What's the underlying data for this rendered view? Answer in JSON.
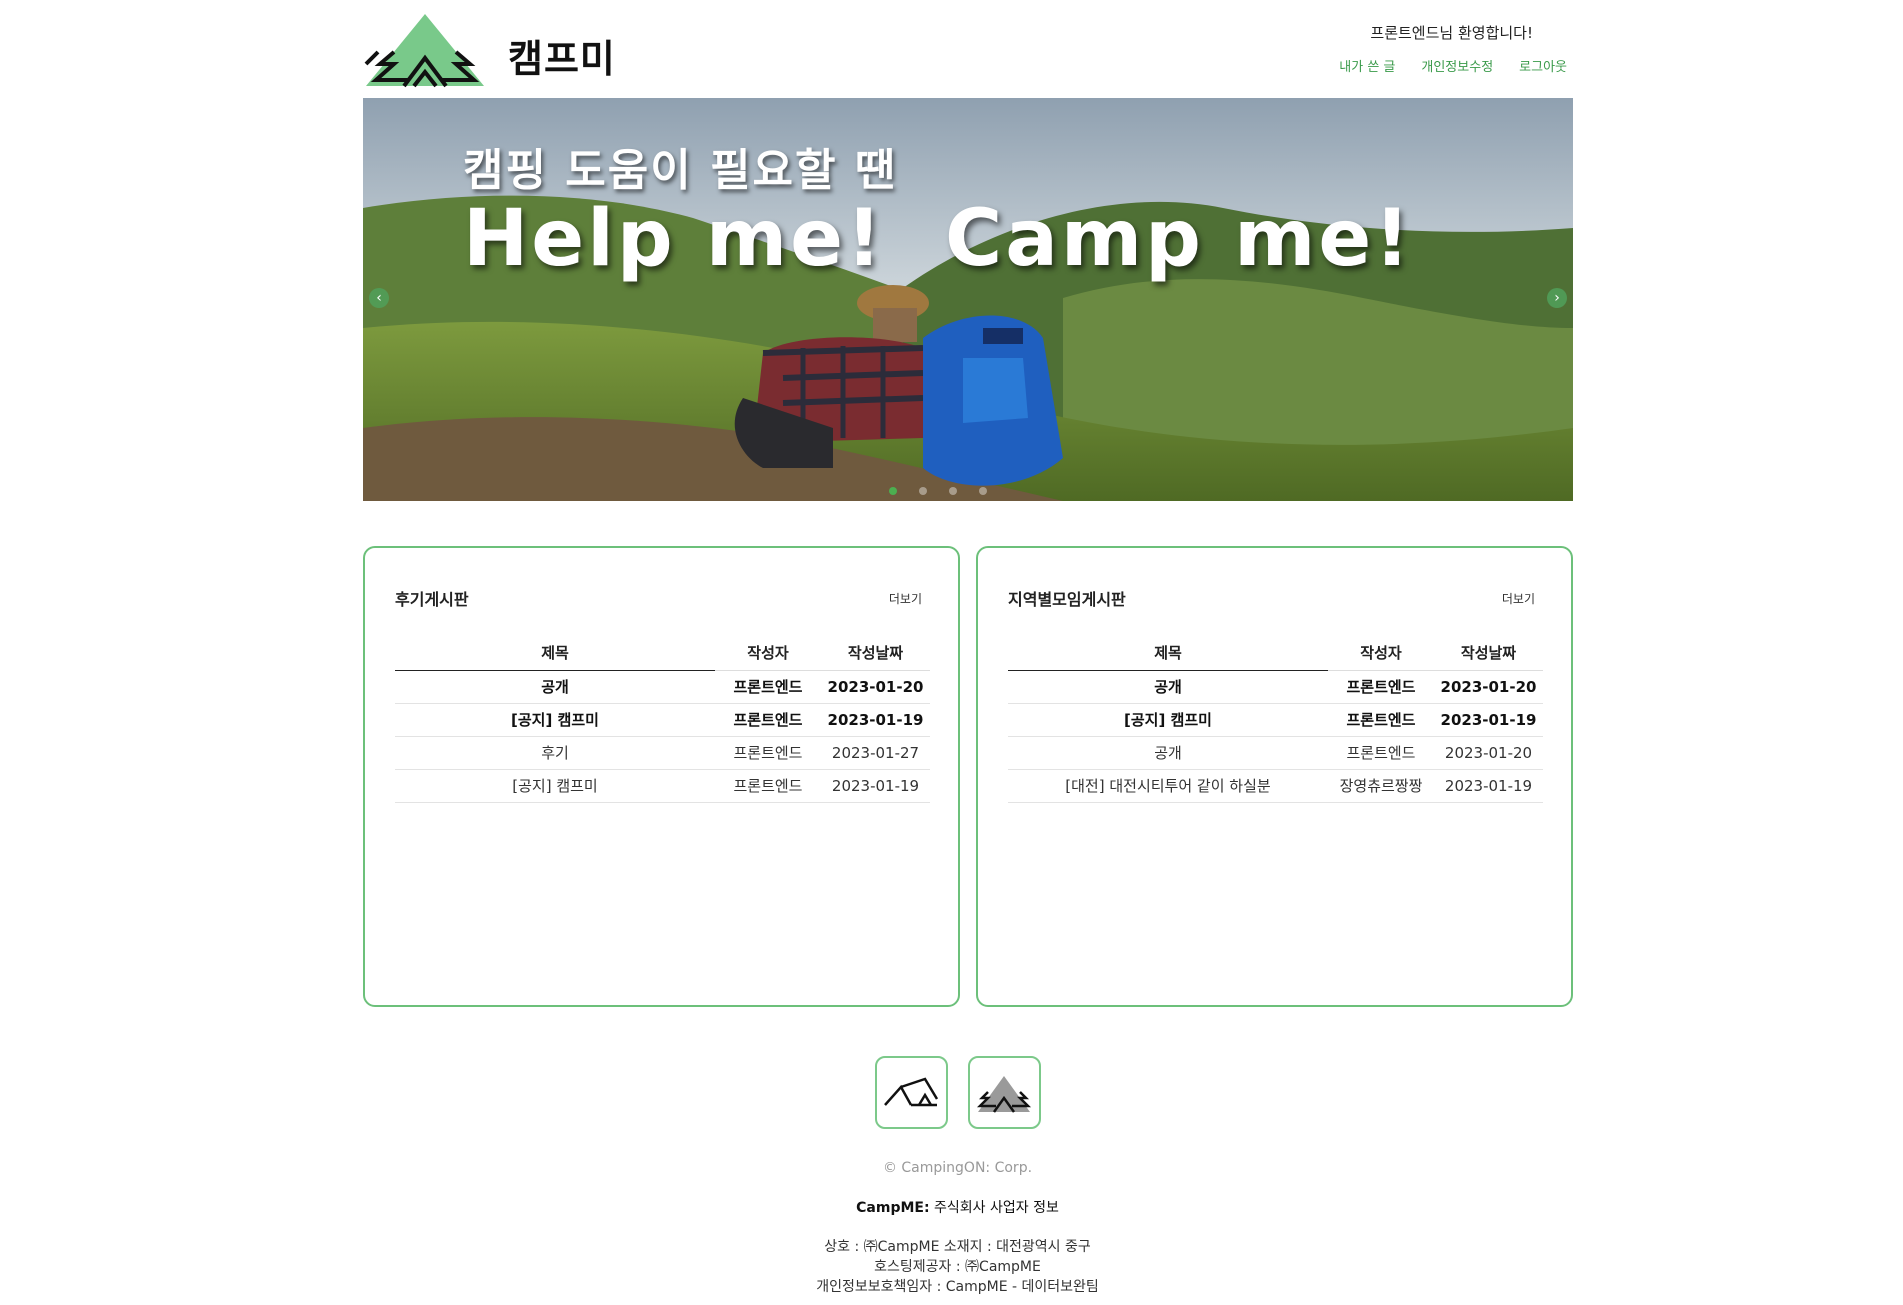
{
  "header": {
    "logo_text": "캠프미",
    "welcome": "프론트엔드님 환영합니다!",
    "links": [
      "내가 쓴 글",
      "개인정보수정",
      "로그아웃"
    ]
  },
  "carousel": {
    "line1": "캠핑 도움이 필요할 땐",
    "line2": "Help me!  Camp me!",
    "slide_count": 4,
    "active_slide": 1
  },
  "boards": {
    "review": {
      "title": "후기게시판",
      "more": "더보기",
      "columns": [
        "제목",
        "작성자",
        "작성날짜"
      ],
      "rows": [
        {
          "title": "공개",
          "author": "프론트엔드",
          "date": "2023-01-20",
          "notice": true
        },
        {
          "title": "[공지] 캠프미",
          "author": "프론트엔드",
          "date": "2023-01-19",
          "notice": true
        },
        {
          "title": "후기",
          "author": "프론트엔드",
          "date": "2023-01-27",
          "notice": false
        },
        {
          "title": "[공지] 캠프미",
          "author": "프론트엔드",
          "date": "2023-01-19",
          "notice": false
        }
      ]
    },
    "region": {
      "title": "지역별모임게시판",
      "more": "더보기",
      "columns": [
        "제목",
        "작성자",
        "작성날짜"
      ],
      "rows": [
        {
          "title": "공개",
          "author": "프론트엔드",
          "date": "2023-01-20",
          "notice": true
        },
        {
          "title": "[공지] 캠프미",
          "author": "프론트엔드",
          "date": "2023-01-19",
          "notice": true
        },
        {
          "title": "공개",
          "author": "프론트엔드",
          "date": "2023-01-20",
          "notice": false
        },
        {
          "title": "[대전] 대전시티투어 같이 하실분",
          "author": "장영츄르짱짱",
          "date": "2023-01-19",
          "notice": false
        }
      ]
    }
  },
  "footer": {
    "copyright": "© CampingON: Corp.",
    "company_bold": "CampME:",
    "company_rest": " 주식회사 사업자 정보",
    "info_lines": [
      "상호 : ㈜CampME 소재지 : 대전광역시 중구",
      "호스팅제공자 : ㈜CampME",
      "개인정보보호책임자 : CampME - 데이터보완팀"
    ]
  },
  "colors": {
    "accent": "#3a9a4a",
    "border": "#6cc07a",
    "logo_green": "#6cc07a"
  }
}
